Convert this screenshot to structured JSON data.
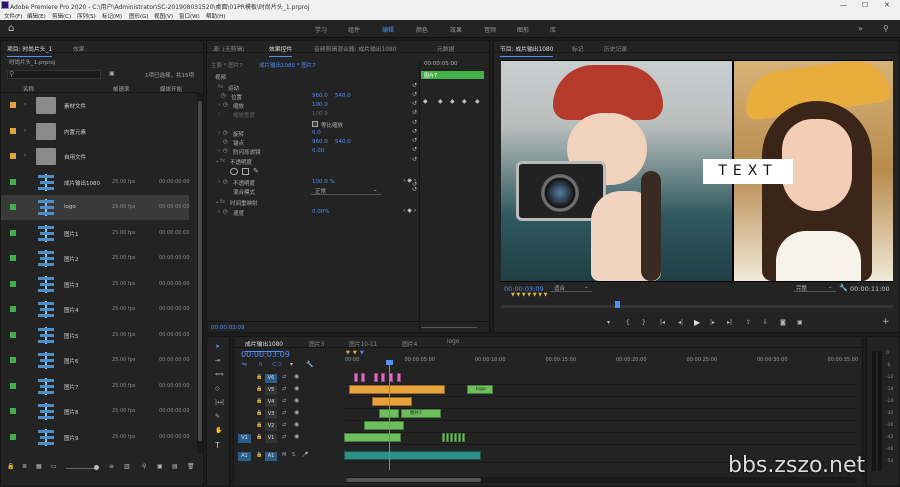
{
  "app": {
    "title": "Adobe Premiere Pro 2020 - C:\\用户\\Administrator\\SC-201908031520\\桌面\\01PR模板\\时尚片头_1.prproj"
  },
  "menu": [
    "文件(F)",
    "编辑(E)",
    "剪辑(C)",
    "序列(S)",
    "标记(M)",
    "图形(G)",
    "视图(V)",
    "窗口(W)",
    "帮助(H)"
  ],
  "workspaces": {
    "tabs": [
      "学习",
      "组件",
      "编辑",
      "颜色",
      "效果",
      "音频",
      "图形",
      "库"
    ],
    "active": "编辑"
  },
  "project": {
    "tab_active": "项目: 时尚片头_1",
    "tab_other": "效果",
    "filename": "时尚片头_1.prproj",
    "selection_info": "1项已选择，共15项",
    "search_placeholder": "",
    "columns": {
      "name": "名称",
      "fps": "帧速率",
      "start": "媒体开始"
    },
    "items": [
      {
        "name": "素材文件",
        "type": "folder",
        "color": "#e8a23b",
        "fps": "",
        "start": ""
      },
      {
        "name": "内置元素",
        "type": "folder",
        "color": "#e8a23b",
        "fps": "",
        "start": ""
      },
      {
        "name": "自用文件",
        "type": "folder",
        "color": "#e8a23b",
        "fps": "",
        "start": ""
      },
      {
        "name": "成片输出1080",
        "type": "seq",
        "color": "#3fb04a",
        "fps": "25.00 fps",
        "start": "00:00:00:00"
      },
      {
        "name": "logo",
        "type": "seq",
        "color": "#3fb04a",
        "fps": "25.00 fps",
        "start": "00:00:00:00",
        "selected": true
      },
      {
        "name": "图片1",
        "type": "seq",
        "color": "#3fb04a",
        "fps": "25.00 fps",
        "start": "00:00:00:00"
      },
      {
        "name": "图片2",
        "type": "seq",
        "color": "#3fb04a",
        "fps": "25.00 fps",
        "start": "00:00:00:00"
      },
      {
        "name": "图片3",
        "type": "seq",
        "color": "#3fb04a",
        "fps": "25.00 fps",
        "start": "00:00:00:00"
      },
      {
        "name": "图片4",
        "type": "seq",
        "color": "#3fb04a",
        "fps": "25.00 fps",
        "start": "00:00:00:00"
      },
      {
        "name": "图片5",
        "type": "seq",
        "color": "#3fb04a",
        "fps": "25.00 fps",
        "start": "00:00:00:00"
      },
      {
        "name": "图片6",
        "type": "seq",
        "color": "#3fb04a",
        "fps": "25.00 fps",
        "start": "00:00:00:00"
      },
      {
        "name": "图片7",
        "type": "seq",
        "color": "#3fb04a",
        "fps": "25.00 fps",
        "start": "00:00:00:00"
      },
      {
        "name": "图片8",
        "type": "seq",
        "color": "#3fb04a",
        "fps": "25.00 fps",
        "start": "00:00:00:00"
      },
      {
        "name": "图片9",
        "type": "seq",
        "color": "#3fb04a",
        "fps": "25.00 fps",
        "start": "00:00:00:00"
      }
    ]
  },
  "effects": {
    "tabs": [
      "源: (无剪辑)",
      "效果控件",
      "音频剪辑混合器: 成片输出1080",
      "元数据"
    ],
    "active_tab": "效果控件",
    "source": "主要 * 图片7",
    "clip": "成片输出1080 * 图片7",
    "kf_time": "00:00:05:00",
    "kf_clip": "图片7",
    "video_section": "视频",
    "motion": "运动",
    "position_label": "位置",
    "position_x": "960.0",
    "position_y": "540.0",
    "scale_label": "缩放",
    "scale_value": "100.0",
    "scale_width_label": "缩放宽度",
    "uniform_label": "等比缩放",
    "rotation_label": "旋转",
    "rotation_value": "0.0",
    "anchor_label": "锚点",
    "anchor_x": "960.0",
    "anchor_y": "540.0",
    "flicker_label": "防闪烁滤镜",
    "flicker_value": "0.00",
    "opacity_section": "不透明度",
    "opacity_label": "不透明度",
    "opacity_value": "100.0 %",
    "blend_label": "混合模式",
    "blend_value": "正常",
    "remap_section": "时间重映射",
    "speed_label": "速度",
    "speed_value": "0.00%",
    "timecode": "00:00:03:09"
  },
  "program": {
    "tabs": [
      "节目: 成片输出1080",
      "标记",
      "历史记录"
    ],
    "overlay_text": "TEXT",
    "timecode": "00:00:03:09",
    "fit": "适合",
    "quality": "完整",
    "duration": "00:00:11:00"
  },
  "timeline": {
    "tabs": [
      "成片输出1080",
      "图片3",
      "图片10-11",
      "图片4",
      "logo"
    ],
    "timecode": "00:00:03:09",
    "ruler": [
      "00:00",
      "00:00:05:00",
      "00:00:10:00",
      "00:00:15:00",
      "00:00:20:00",
      "00:00:25:00",
      "00:00:30:00",
      "00:00:35:00"
    ],
    "tracks": [
      "V6",
      "V5",
      "V4",
      "V3",
      "V2",
      "V1",
      "A1"
    ],
    "src_v": "V1",
    "src_a": "A1",
    "clips": [
      {
        "label": "logo",
        "track": "V5"
      },
      {
        "label": "图片7",
        "track": "V3"
      }
    ],
    "audio_db": [
      "0",
      "-6",
      "-12",
      "-18",
      "-24",
      "-30",
      "-36",
      "-42",
      "-48",
      "-54"
    ]
  },
  "colors": {
    "accent": "#4f8ff7",
    "label_orange": "#e8a23b",
    "label_green": "#3fb04a",
    "clip_pink": "#e06bc7",
    "clip_green": "#6cbf5c",
    "clip_orange": "#e8a23b",
    "clip_teal": "#2f8f88"
  }
}
